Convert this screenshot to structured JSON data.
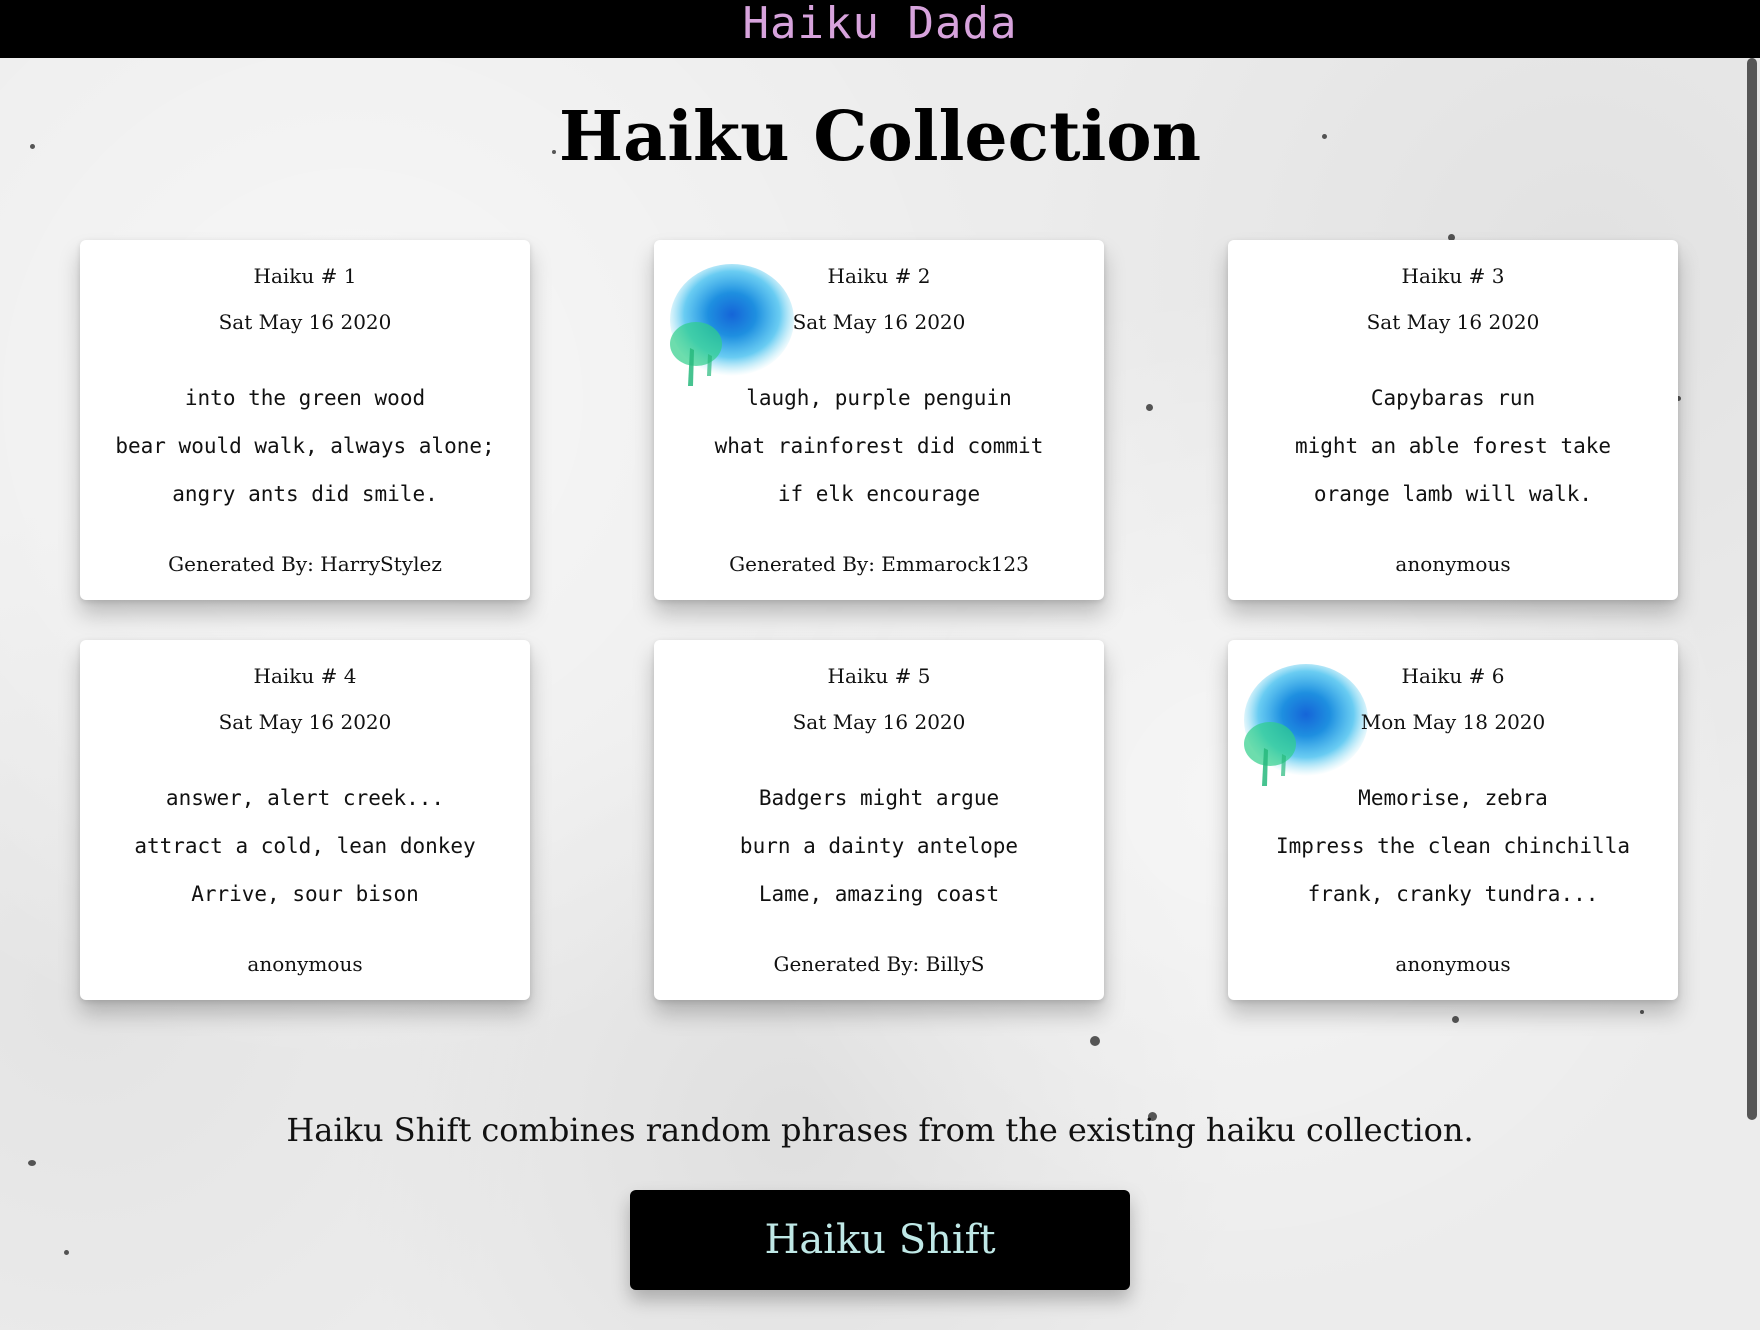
{
  "app": {
    "brand": "Haiku Dada"
  },
  "main": {
    "title": "Haiku Collection",
    "cards": [
      {
        "number": "Haiku # 1",
        "date": "Sat May 16 2020",
        "lines": [
          "into the green wood",
          "bear would walk, always alone;",
          "angry ants did smile."
        ],
        "author": "Generated By: HarryStylez",
        "has_splash": false
      },
      {
        "number": "Haiku # 2",
        "date": "Sat May 16 2020",
        "lines": [
          "laugh, purple penguin",
          "what rainforest did commit",
          "if elk encourage"
        ],
        "author": "Generated By: Emmarock123",
        "has_splash": true
      },
      {
        "number": "Haiku # 3",
        "date": "Sat May 16 2020",
        "lines": [
          "Capybaras run",
          "might an able forest take",
          "orange lamb will walk."
        ],
        "author": "anonymous",
        "has_splash": false
      },
      {
        "number": "Haiku # 4",
        "date": "Sat May 16 2020",
        "lines": [
          "answer, alert creek...",
          "attract a cold, lean donkey",
          "Arrive, sour bison"
        ],
        "author": "anonymous",
        "has_splash": false
      },
      {
        "number": "Haiku # 5",
        "date": "Sat May 16 2020",
        "lines": [
          "Badgers might argue",
          "burn a dainty antelope",
          "Lame, amazing coast"
        ],
        "author": "Generated By: BillyS",
        "has_splash": false
      },
      {
        "number": "Haiku # 6",
        "date": "Mon May 18 2020",
        "lines": [
          "Memorise, zebra",
          "Impress the clean chinchilla",
          "frank, cranky tundra..."
        ],
        "author": "anonymous",
        "has_splash": true
      }
    ],
    "description": "Haiku Shift combines random phrases from the existing haiku collection.",
    "button_label": "Haiku Shift"
  },
  "colors": {
    "topbar": "#000000",
    "brand": "#d7a3dc",
    "button_bg": "#000000",
    "button_text": "#bfe8e6",
    "splash_blue": "#1e8fe0",
    "splash_green": "#2fcf8a"
  },
  "icons": {
    "splash": "paint-splash-icon"
  }
}
